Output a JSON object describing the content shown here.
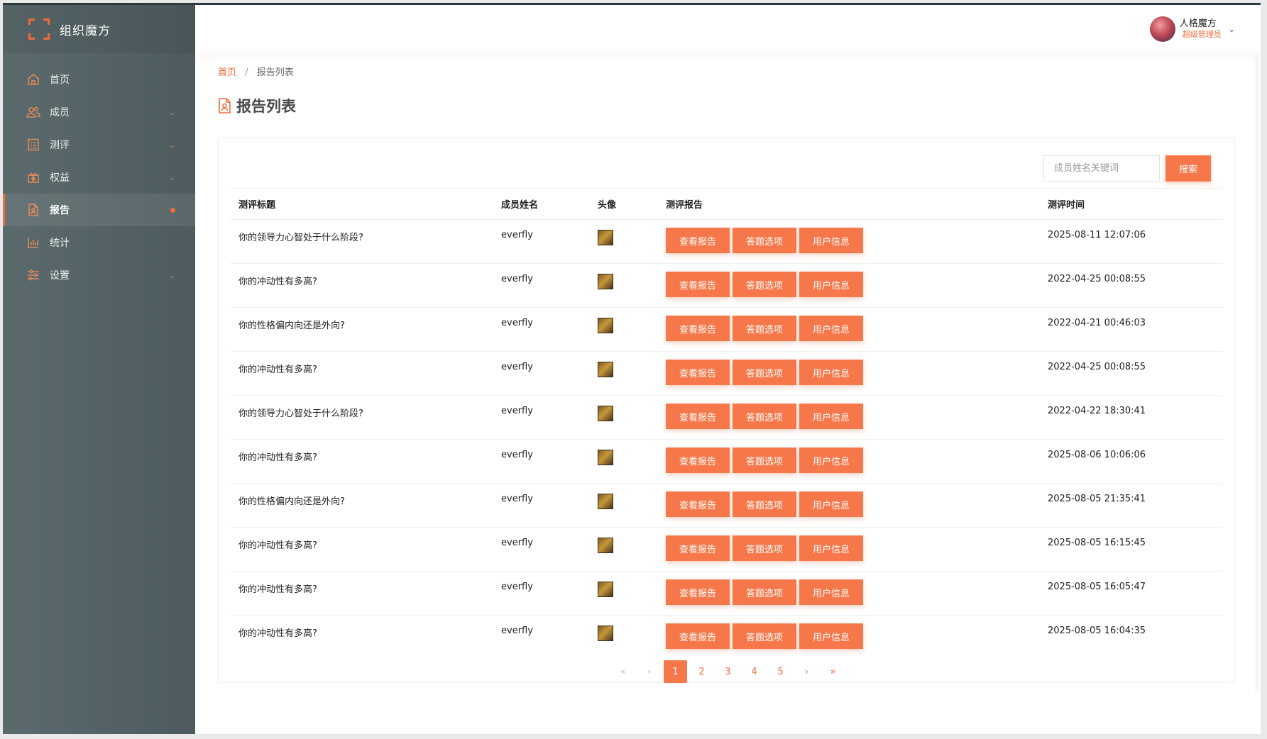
{
  "brand": {
    "name": "组织魔方"
  },
  "sidebar": {
    "items": [
      {
        "label": "首页",
        "icon": "home-icon",
        "expandable": false
      },
      {
        "label": "成员",
        "icon": "users-icon",
        "expandable": true
      },
      {
        "label": "测评",
        "icon": "checklist-icon",
        "expandable": true
      },
      {
        "label": "权益",
        "icon": "gift-icon",
        "expandable": true
      },
      {
        "label": "报告",
        "icon": "report-icon",
        "expandable": false,
        "active": true
      },
      {
        "label": "统计",
        "icon": "bar-chart-icon",
        "expandable": false
      },
      {
        "label": "设置",
        "icon": "sliders-icon",
        "expandable": true
      }
    ]
  },
  "user": {
    "name": "人格魔方",
    "role": "超级管理员"
  },
  "breadcrumb": {
    "home": "首页",
    "separator": "/",
    "current": "报告列表"
  },
  "page": {
    "title": "报告列表"
  },
  "search": {
    "placeholder": "成员姓名关键词",
    "button": "搜索"
  },
  "table": {
    "headers": {
      "title": "测评标题",
      "name": "成员姓名",
      "avatar": "头像",
      "report": "测评报告",
      "time": "测评时间"
    },
    "actions": {
      "view": "查看报告",
      "answers": "答题选项",
      "user": "用户信息"
    },
    "rows": [
      {
        "title": "你的领导力心智处于什么阶段?",
        "name": "everfly",
        "time": "2025-08-11 12:07:06"
      },
      {
        "title": "你的冲动性有多高?",
        "name": "everfly",
        "time": "2022-04-25 00:08:55"
      },
      {
        "title": "你的性格偏内向还是外向?",
        "name": "everfly",
        "time": "2022-04-21 00:46:03"
      },
      {
        "title": "你的冲动性有多高?",
        "name": "everfly",
        "time": "2022-04-25 00:08:55"
      },
      {
        "title": "你的领导力心智处于什么阶段?",
        "name": "everfly",
        "time": "2022-04-22 18:30:41"
      },
      {
        "title": "你的冲动性有多高?",
        "name": "everfly",
        "time": "2025-08-06 10:06:06"
      },
      {
        "title": "你的性格偏内向还是外向?",
        "name": "everfly",
        "time": "2025-08-05 21:35:41"
      },
      {
        "title": "你的冲动性有多高?",
        "name": "everfly",
        "time": "2025-08-05 16:15:45"
      },
      {
        "title": "你的冲动性有多高?",
        "name": "everfly",
        "time": "2025-08-05 16:05:47"
      },
      {
        "title": "你的冲动性有多高?",
        "name": "everfly",
        "time": "2025-08-05 16:04:35"
      }
    ]
  },
  "pagination": {
    "first": "«",
    "prev": "‹",
    "next": "›",
    "last": "»",
    "pages": [
      "1",
      "2",
      "3",
      "4",
      "5"
    ],
    "current": "1"
  },
  "colors": {
    "accent": "#f6774a",
    "sidebar": "#56656a"
  }
}
